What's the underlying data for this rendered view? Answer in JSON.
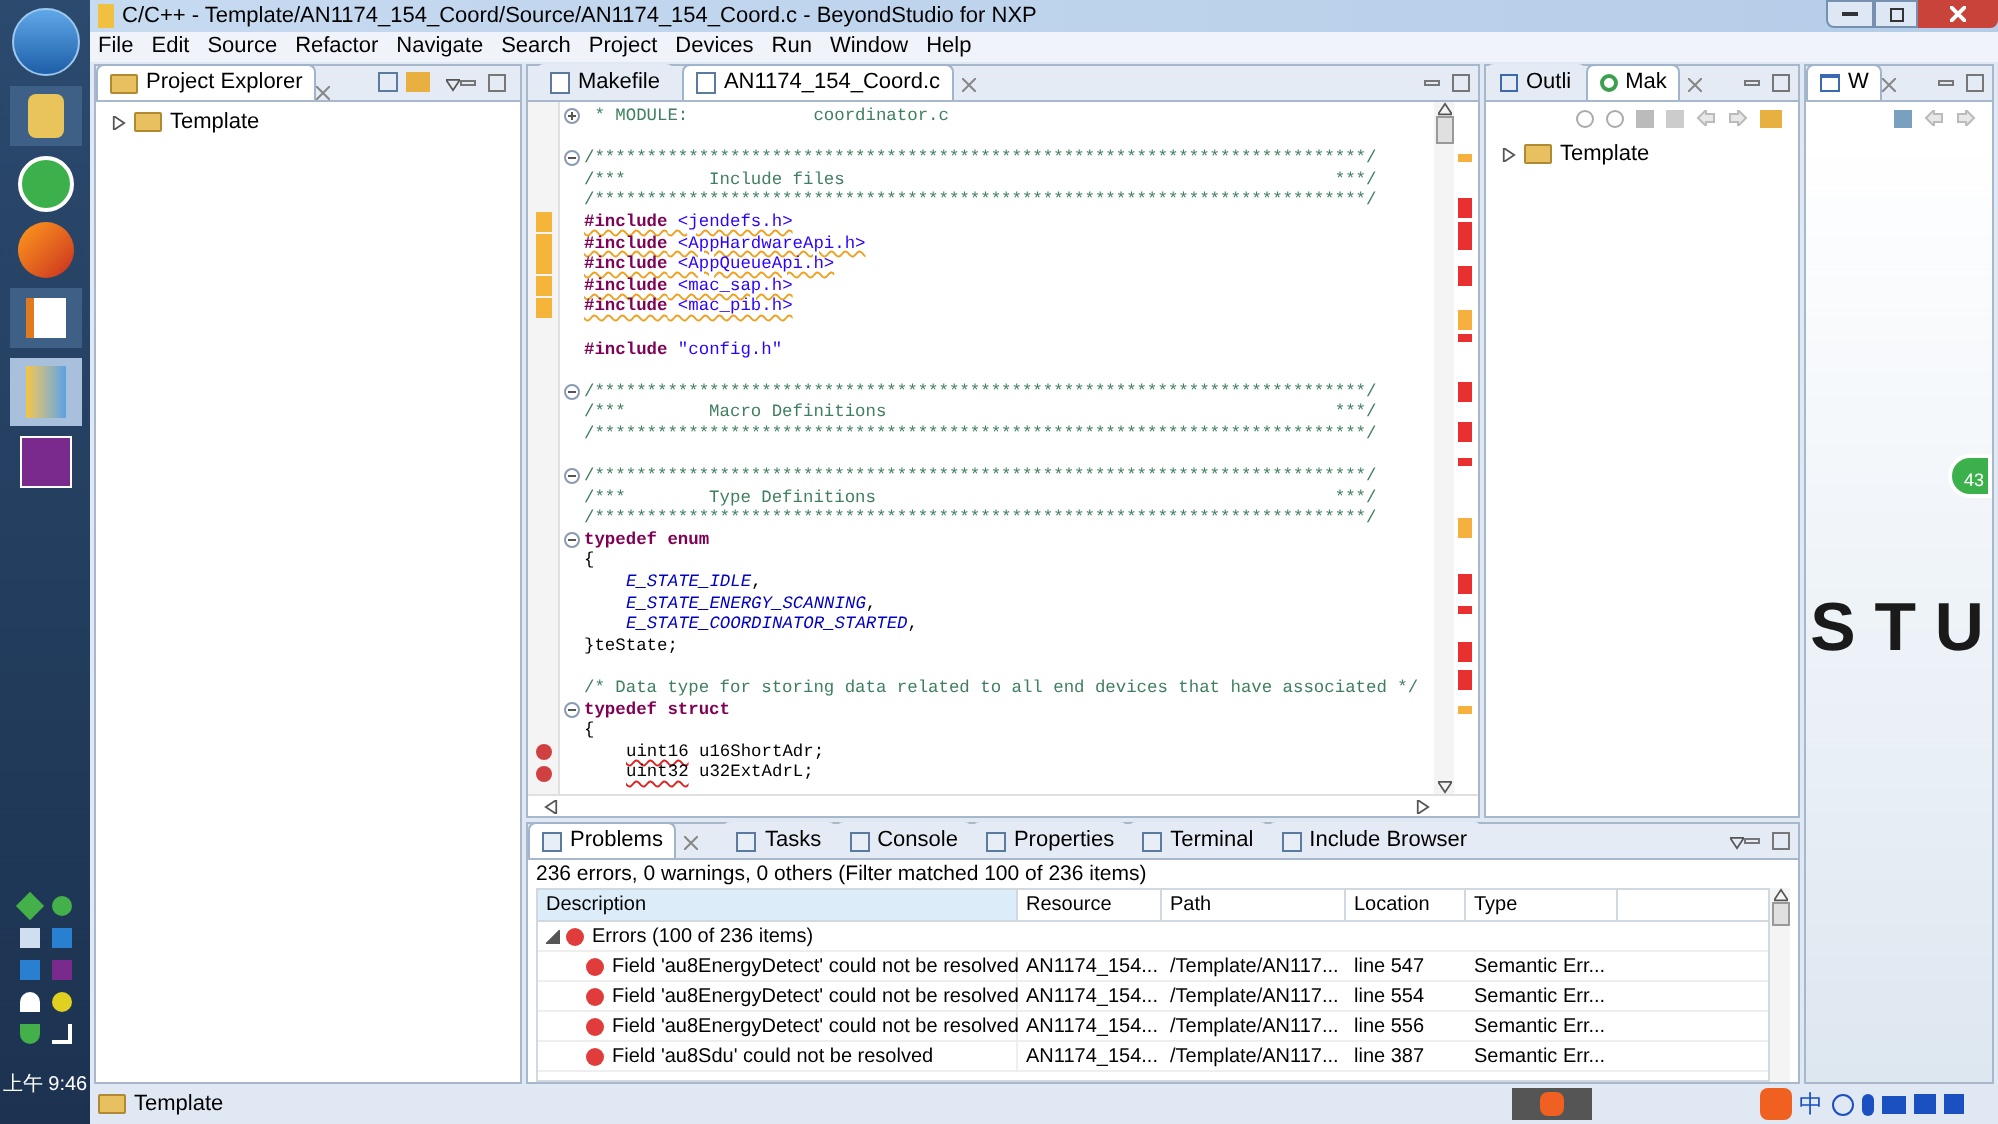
{
  "window": {
    "title": "C/C++ - Template/AN1174_154_Coord/Source/AN1174_154_Coord.c - BeyondStudio for NXP"
  },
  "menu": [
    "File",
    "Edit",
    "Source",
    "Refactor",
    "Navigate",
    "Search",
    "Project",
    "Devices",
    "Run",
    "Window",
    "Help"
  ],
  "project_explorer": {
    "tab": "Project Explorer",
    "tree": [
      {
        "label": "Template",
        "expanded": false
      }
    ]
  },
  "editor": {
    "tabs": [
      {
        "label": "Makefile",
        "selected": false
      },
      {
        "label": "AN1174_154_Coord.c",
        "selected": true
      }
    ],
    "lines": [
      {
        "expanded": false,
        "segments": [
          {
            "kind": "comment",
            "text": " * MODULE:            coordinator.c"
          }
        ]
      },
      {
        "gap_before": true,
        "expanded": true,
        "segments": [
          {
            "kind": "comment",
            "text": "/**************************************************************************/"
          }
        ]
      },
      {
        "segments": [
          {
            "kind": "comment",
            "text": "/***        Include files                                               ***/"
          }
        ]
      },
      {
        "segments": [
          {
            "kind": "comment",
            "text": "/**************************************************************************/"
          }
        ]
      },
      {
        "warning": true,
        "segments": [
          {
            "kind": "directive",
            "text": "#include",
            "warning": true
          },
          {
            "kind": "header",
            "text": " <jendefs.h>",
            "warning": true
          }
        ]
      },
      {
        "warning": true,
        "segments": [
          {
            "kind": "directive",
            "text": "#include",
            "warning": true
          },
          {
            "kind": "header",
            "text": " <AppHardwareApi.h>",
            "warning": true
          }
        ]
      },
      {
        "warning": true,
        "segments": [
          {
            "kind": "directive",
            "text": "#include",
            "warning": true
          },
          {
            "kind": "header",
            "text": " <AppQueueApi.h>",
            "warning": true
          }
        ]
      },
      {
        "warning": true,
        "segments": [
          {
            "kind": "directive",
            "text": "#include",
            "warning": true
          },
          {
            "kind": "header",
            "text": " <mac_sap.h>",
            "warning": true
          }
        ]
      },
      {
        "warning": true,
        "segments": [
          {
            "kind": "directive",
            "text": "#include",
            "warning": true
          },
          {
            "kind": "header",
            "text": " <mac_pib.h>",
            "warning": true
          }
        ]
      },
      {
        "gap_before": true,
        "segments": [
          {
            "kind": "directive",
            "text": "#include"
          },
          {
            "kind": "header",
            "text": " \"config.h\""
          }
        ]
      },
      {
        "gap_before": true,
        "expanded": true,
        "segments": [
          {
            "kind": "comment",
            "text": "/**************************************************************************/"
          }
        ]
      },
      {
        "segments": [
          {
            "kind": "comment",
            "text": "/***        Macro Definitions                                           ***/"
          }
        ]
      },
      {
        "segments": [
          {
            "kind": "comment",
            "text": "/**************************************************************************/"
          }
        ]
      },
      {
        "gap_before": true,
        "expanded": true,
        "segments": [
          {
            "kind": "comment",
            "text": "/**************************************************************************/"
          }
        ]
      },
      {
        "segments": [
          {
            "kind": "comment",
            "text": "/***        Type Definitions                                            ***/"
          }
        ]
      },
      {
        "segments": [
          {
            "kind": "comment",
            "text": "/**************************************************************************/"
          }
        ]
      },
      {
        "expanded": true,
        "segments": [
          {
            "kind": "keyword",
            "text": "typedef enum"
          }
        ]
      },
      {
        "segments": [
          {
            "kind": "plain",
            "text": "{"
          }
        ]
      },
      {
        "indented": true,
        "segments": [
          {
            "kind": "enumerator",
            "text": "E_STATE_IDLE"
          },
          {
            "kind": "plain",
            "text": ","
          }
        ]
      },
      {
        "indented": true,
        "segments": [
          {
            "kind": "enumerator",
            "text": "E_STATE_ENERGY_SCANNING"
          },
          {
            "kind": "plain",
            "text": ","
          }
        ]
      },
      {
        "indented": true,
        "segments": [
          {
            "kind": "enumerator",
            "text": "E_STATE_COORDINATOR_STARTED"
          },
          {
            "kind": "plain",
            "text": ","
          }
        ]
      },
      {
        "segments": [
          {
            "kind": "plain",
            "text": "}teState;"
          }
        ]
      },
      {
        "gap_before": true,
        "segments": [
          {
            "kind": "comment",
            "text": "/* Data type for storing data related to all end devices that have associated */"
          }
        ]
      },
      {
        "expanded": true,
        "segments": [
          {
            "kind": "keyword",
            "text": "typedef struct"
          }
        ]
      },
      {
        "segments": [
          {
            "kind": "plain",
            "text": "{"
          }
        ]
      },
      {
        "error": true,
        "indented": true,
        "segments": [
          {
            "kind": "plain",
            "text": "uint16",
            "error": true
          },
          {
            "kind": "plain",
            "text": " u16ShortAdr;"
          }
        ]
      },
      {
        "error": true,
        "indented": true,
        "segments": [
          {
            "kind": "plain",
            "text": "uint32",
            "error": true
          },
          {
            "kind": "plain",
            "text": " u32ExtAdrL;"
          }
        ]
      }
    ]
  },
  "make_pane": {
    "tabs": [
      {
        "label": "Outli",
        "selected": false
      },
      {
        "label": "Mak",
        "selected": true
      }
    ],
    "tree": [
      {
        "label": "Template",
        "expanded": false
      }
    ]
  },
  "web_pane": {
    "tab": "W",
    "banner": "S T U",
    "badge": "43"
  },
  "problems": {
    "tabs": [
      {
        "label": "Problems",
        "selected": true
      },
      {
        "label": "Tasks",
        "selected": false
      },
      {
        "label": "Console",
        "selected": false
      },
      {
        "label": "Properties",
        "selected": false
      },
      {
        "label": "Terminal",
        "selected": false
      },
      {
        "label": "Include Browser",
        "selected": false
      }
    ],
    "summary": "236 errors, 0 warnings, 0 others (Filter matched 100 of 236 items)",
    "columns": [
      "Description",
      "Resource",
      "Path",
      "Location",
      "Type"
    ],
    "groups": [
      {
        "label": "Errors (100 of 236 items)",
        "expanded": true,
        "rows": [
          {
            "description": "Field 'au8EnergyDetect' could not be resolved",
            "resource": "AN1174_154...",
            "path": "/Template/AN117...",
            "location": "line 547",
            "type": "Semantic Err..."
          },
          {
            "description": "Field 'au8EnergyDetect' could not be resolved",
            "resource": "AN1174_154...",
            "path": "/Template/AN117...",
            "location": "line 554",
            "type": "Semantic Err..."
          },
          {
            "description": "Field 'au8EnergyDetect' could not be resolved",
            "resource": "AN1174_154...",
            "path": "/Template/AN117...",
            "location": "line 556",
            "type": "Semantic Err..."
          },
          {
            "description": "Field 'au8Sdu' could not be resolved",
            "resource": "AN1174_154...",
            "path": "/Template/AN117...",
            "location": "line 387",
            "type": "Semantic Err..."
          }
        ]
      }
    ]
  },
  "status_bar": {
    "text": "Template"
  },
  "taskbar": {
    "clock": "上午 9:46",
    "ime": "中"
  }
}
